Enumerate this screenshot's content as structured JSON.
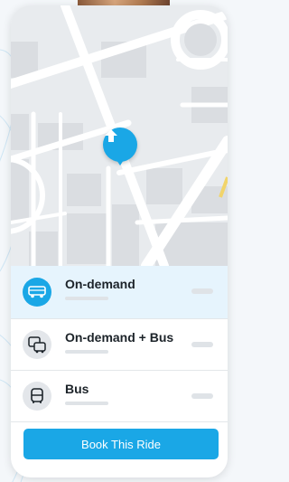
{
  "map": {
    "pin_icon": "arrow-up-icon"
  },
  "ride_options": [
    {
      "title": "On-demand",
      "icon": "van-icon",
      "selected": true
    },
    {
      "title": "On-demand + Bus",
      "icon": "van-bus-icon",
      "selected": false
    },
    {
      "title": "Bus",
      "icon": "bus-icon",
      "selected": false
    }
  ],
  "book_button": {
    "label": "Book This Ride"
  },
  "colors": {
    "accent": "#1aa7e6",
    "selected_bg": "#e6f4fd",
    "map_bg": "#e9ecef"
  }
}
